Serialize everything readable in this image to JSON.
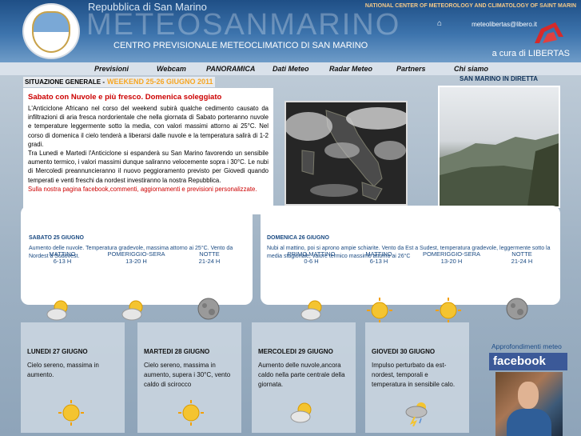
{
  "header": {
    "republic": "Repubblica di San Marino",
    "brand": "METEOSANMARINO",
    "subtitle": "CENTRO PREVISIONALE METEOCLIMATICO DI SAN MARINO",
    "national_center": "NATIONAL CENTER OF METEOROLOGY AND CLIMATOLOGY OF SAINT MARIN",
    "email": "meteolibertas@libero.it",
    "acura": "a cura di  LIBERTAS"
  },
  "nav": [
    "Previsioni",
    "Webcam",
    "PANORAMICA",
    "Dati Meteo",
    "Radar Meteo",
    "Partners",
    "Chi siamo"
  ],
  "situazione": {
    "label": "SITUAZIONE GENERALE -",
    "weekend": "WEEKEND 25-26 GIUGNO 2011"
  },
  "diretta_label": "SAN MARINO IN DIRETTA",
  "article": {
    "title": "Sabato con Nuvole e più fresco. Domenica soleggiato",
    "p1": "L'Anticiclone Africano nel corso del weekend subirà qualche cedimento causato da infiltrazioni di aria fresca nordorientale che nella giornata di Sabato porteranno nuvole e temperature leggermente sotto la media, con valori massimi attorno ai 25°C. Nel corso di domenica il cielo tenderà a liberarsi dalle nuvole e la temperatura salirà di 1-2 gradi.",
    "p2": "Tra Lunedi e Martedi l'Anticiclone si espanderà su San Marino favorendo un sensibile aumento termico, i valori massimi dunque saliranno velocemente sopra i 30°C. Le nubi di Mercoledi preannuncieranno il nuovo peggioramento previsto per Giovedi quando temperati e venti freschi da nordest investiranno la nostra Repubblica.",
    "p3": "Sulla nostra pagina facebook,commenti, aggiornamenti e previsioni personalizzate."
  },
  "saturday": {
    "day": "SABATO 25 GIUGNO",
    "text": "Aumento delle nuvole. Temperatura gradevole, massima attorno ai 25°C. Vento da Nordest a Sudovest.",
    "periods": [
      {
        "name": "MATTINO",
        "hours": "6-13 H"
      },
      {
        "name": "POMERIGGIO-SERA",
        "hours": "13-20 H"
      },
      {
        "name": "NOTTE",
        "hours": "21-24 H"
      }
    ],
    "icons": [
      "partly-cloudy-icon",
      "partly-cloudy-icon",
      "moon-icon"
    ]
  },
  "sunday": {
    "day": "DOMENICA 26 GIUGNO",
    "text": "Nubi al mattino, poi si aprono ampie schiarite. Vento da Est a Sudest, temperatura gradevole, leggermente sotto la media stagionale, valore termico massimo attorno ai 26°C",
    "periods": [
      {
        "name": "PRIMO MATTINO",
        "hours": "0-6 H"
      },
      {
        "name": "MATTINO",
        "hours": "6-13 H"
      },
      {
        "name": "POMERIGGIO-SERA",
        "hours": "13-20 H"
      },
      {
        "name": "NOTTE",
        "hours": "21-24 H"
      }
    ],
    "icons": [
      "partly-cloudy-icon",
      "sun-icon",
      "sun-icon",
      "moon-icon"
    ]
  },
  "days": [
    {
      "day": "LUNEDI 27 GIUGNO",
      "text": "Cielo sereno, massima in aumento.",
      "icon": "sun-icon"
    },
    {
      "day": "MARTEDI 28 GIUGNO",
      "text": "Cielo sereno, massima in aumento, supera i 30°C, vento caldo di scirocco",
      "icon": "sun-icon"
    },
    {
      "day": "MERCOLEDI 29 GIUGNO",
      "text": "Aumento delle nuvole,ancora caldo nella parte centrale della giornata.",
      "icon": "partly-cloudy-icon"
    },
    {
      "day": "GIOVEDI 30 GIUGNO",
      "text": "Impulso perturbato da est-nordest, temporali e temperatura in sensibile calo.",
      "icon": "thunderstorm-icon"
    }
  ],
  "sidebar": {
    "approf": "Approfondimenti meteo",
    "facebook": "facebook"
  },
  "colors": {
    "header": "#2f65a1",
    "brand_red": "#cc0000",
    "accent_orange": "#f6a623",
    "facebook": "#3b5998"
  }
}
